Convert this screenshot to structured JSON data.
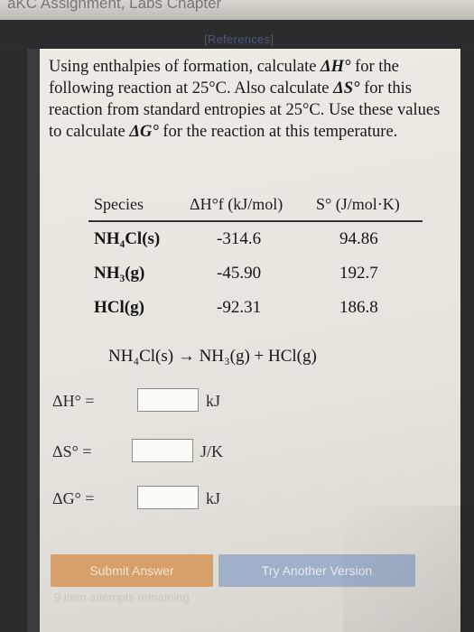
{
  "header": {
    "cropped_text": "aKC Assignment, Labs Chapter",
    "references_label": "[References]"
  },
  "question": {
    "line1": "Using enthalpies of formation, calculate",
    "dh_symbol": "ΔH°",
    "line1b": "for",
    "line2a": "the following reaction at 25°C. Also calculate",
    "ds_symbol": "ΔS°",
    "line3": "for this reaction from standard entropies at 25°C.",
    "line4a": "Use these values to calculate",
    "dg_symbol": "ΔG°",
    "line4b": "for the reaction",
    "line5": "at this temperature."
  },
  "table": {
    "headers": {
      "species": "Species",
      "dhf": "ΔH°f (kJ/mol)",
      "s": "S° (J/mol·K)"
    },
    "rows": [
      {
        "species": "NH₄Cl(s)",
        "dhf": "-314.6",
        "s": "94.86"
      },
      {
        "species": "NH₃(g)",
        "dhf": "-45.90",
        "s": "192.7"
      },
      {
        "species": "HCl(g)",
        "dhf": "-92.31",
        "s": "186.8"
      }
    ]
  },
  "equation": "NH₄Cl(s) → NH₃(g) + HCl(g)",
  "answers": [
    {
      "label": "ΔH° =",
      "value": "",
      "unit": "kJ"
    },
    {
      "label": "ΔS° =",
      "value": "",
      "unit": "J/K"
    },
    {
      "label": "ΔG° =",
      "value": "",
      "unit": "kJ"
    }
  ],
  "buttons": {
    "submit": "Submit Answer",
    "try_another": "Try Another Version"
  },
  "attempts_text": "9 item attempts remaining",
  "colors": {
    "panel": "#e9e6df",
    "submit": "#d7a06a",
    "try_another": "#9fb0c8"
  }
}
